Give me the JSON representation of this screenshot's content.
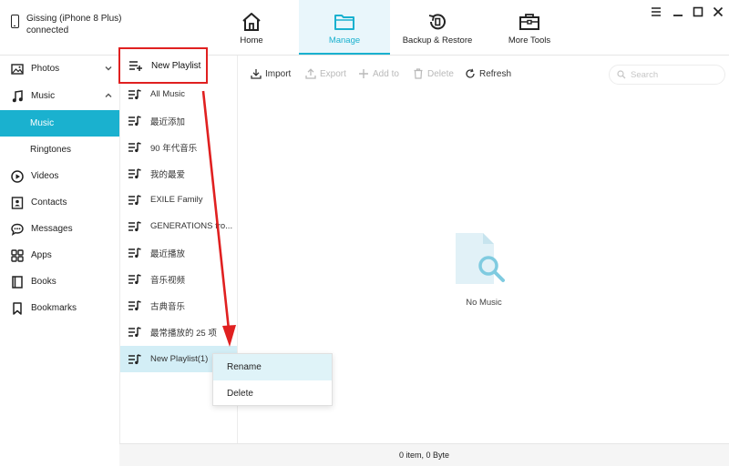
{
  "device": {
    "name": "Gissing (iPhone 8 Plus)",
    "status": "connected"
  },
  "nav": {
    "home": "Home",
    "manage": "Manage",
    "backup": "Backup & Restore",
    "more": "More Tools"
  },
  "sidebar": {
    "items": [
      {
        "label": "Photos"
      },
      {
        "label": "Music"
      },
      {
        "label": "Music"
      },
      {
        "label": "Ringtones"
      },
      {
        "label": "Videos"
      },
      {
        "label": "Contacts"
      },
      {
        "label": "Messages"
      },
      {
        "label": "Apps"
      },
      {
        "label": "Books"
      },
      {
        "label": "Bookmarks"
      }
    ]
  },
  "playlists": {
    "new_label": "New Playlist",
    "items": [
      "All Music",
      "最近添加",
      "90 年代音乐",
      "我的最爱",
      "EXILE Family",
      "GENERATIONS fro...",
      "最近播放",
      "音乐视频",
      "古典音乐",
      "最常播放的 25 项",
      "New Playlist(1)"
    ]
  },
  "toolbar": {
    "import": "Import",
    "export": "Export",
    "add": "Add to",
    "delete": "Delete",
    "refresh": "Refresh",
    "search_placeholder": "Search"
  },
  "empty": {
    "message": "No Music"
  },
  "status": {
    "text": "0 item, 0 Byte"
  },
  "context_menu": {
    "rename": "Rename",
    "delete": "Delete"
  },
  "colors": {
    "accent": "#1ab1cf",
    "annotation": "#e02020"
  }
}
